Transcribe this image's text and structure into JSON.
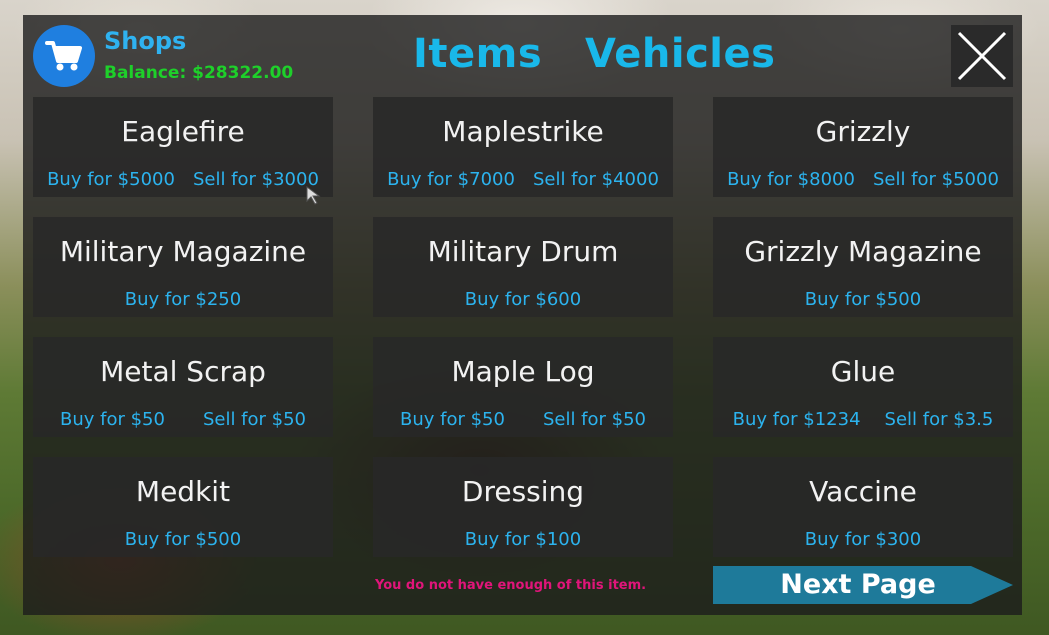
{
  "header": {
    "title": "Shops",
    "balance": "Balance: $28322.00",
    "cart_icon": "shopping-cart-icon",
    "close_icon": "close-icon"
  },
  "tabs": [
    {
      "label": "Items"
    },
    {
      "label": "Vehicles"
    }
  ],
  "items": [
    {
      "name": "Eaglefire",
      "buy": "Buy for $5000",
      "sell": "Sell for $3000"
    },
    {
      "name": "Maplestrike",
      "buy": "Buy for $7000",
      "sell": "Sell for $4000"
    },
    {
      "name": "Grizzly",
      "buy": "Buy for $8000",
      "sell": "Sell for $5000"
    },
    {
      "name": "Military Magazine",
      "buy": "Buy for $250"
    },
    {
      "name": "Military Drum",
      "buy": "Buy for $600"
    },
    {
      "name": "Grizzly Magazine",
      "buy": "Buy for $500"
    },
    {
      "name": "Metal Scrap",
      "buy": "Buy for $50",
      "sell": "Sell for $50"
    },
    {
      "name": "Maple Log",
      "buy": "Buy for $50",
      "sell": "Sell for $50"
    },
    {
      "name": "Glue",
      "buy": "Buy for $1234",
      "sell": "Sell for $3.5"
    },
    {
      "name": "Medkit",
      "buy": "Buy for $500"
    },
    {
      "name": "Dressing",
      "buy": "Buy for $100"
    },
    {
      "name": "Vaccine",
      "buy": "Buy for $300"
    }
  ],
  "footer": {
    "warning": "You do not have enough of this item.",
    "next_page": "Next Page"
  },
  "colors": {
    "accent_blue": "#19b8ea",
    "balance_green": "#1ed02a",
    "warning_pink": "#e0157a",
    "next_button": "#1e7a9a"
  }
}
